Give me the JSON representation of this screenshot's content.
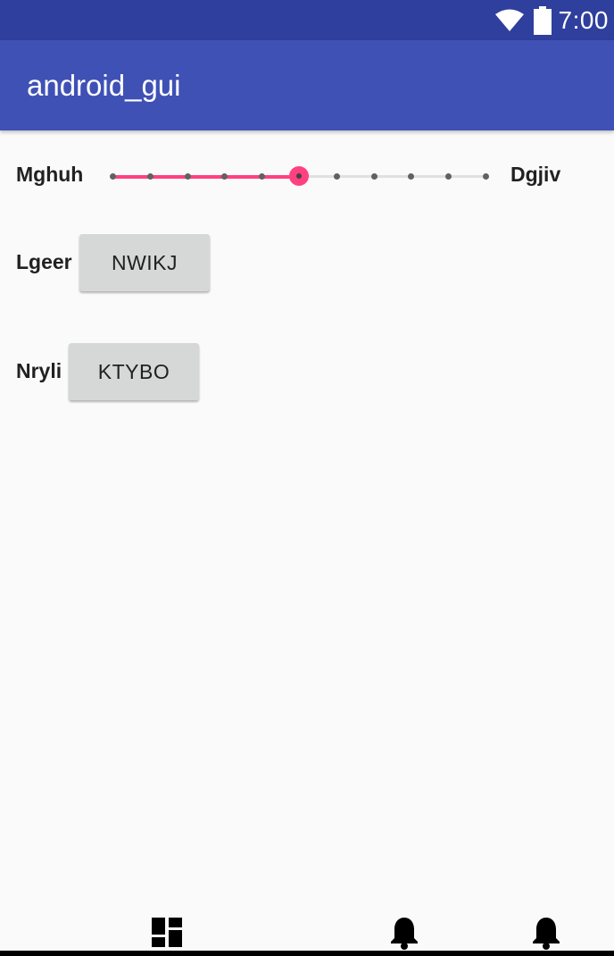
{
  "status_bar": {
    "time": "7:00",
    "icons": [
      "wifi-icon",
      "battery-icon"
    ]
  },
  "app_bar": {
    "title": "android_gui"
  },
  "seekbar_row": {
    "left_label": "Mghuh",
    "right_label": "Dgjiv",
    "max": 10,
    "progress": 5,
    "accent": "#ff4081"
  },
  "rows": [
    {
      "label": "Lgeer",
      "button": "NWIKJ"
    },
    {
      "label": "Nryli",
      "button": "KTYBO"
    }
  ],
  "bottom_icons": [
    "dashboard-icon",
    "notification-bell-icon",
    "notification-bell-icon"
  ],
  "colors": {
    "status_bar": "#2f3f9e",
    "app_bar": "#3f51b5",
    "background": "#fafafa",
    "button": "#d6d7d7"
  }
}
